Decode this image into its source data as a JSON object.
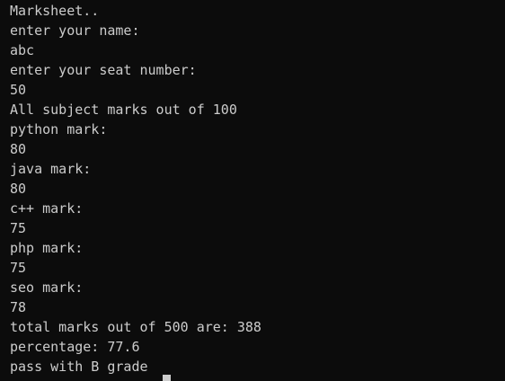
{
  "terminal": {
    "lines": [
      "Marksheet..",
      "enter your name:",
      "abc",
      "enter your seat number:",
      "50",
      "All subject marks out of 100",
      "python mark:",
      "80",
      "java mark:",
      "80",
      "c++ mark:",
      "75",
      "php mark:",
      "75",
      "seo mark:",
      "78",
      "total marks out of 500 are: 388",
      "percentage: 77.6",
      "pass with B grade"
    ]
  },
  "colors": {
    "background": "#0c0c0c",
    "text": "#cccccc"
  }
}
